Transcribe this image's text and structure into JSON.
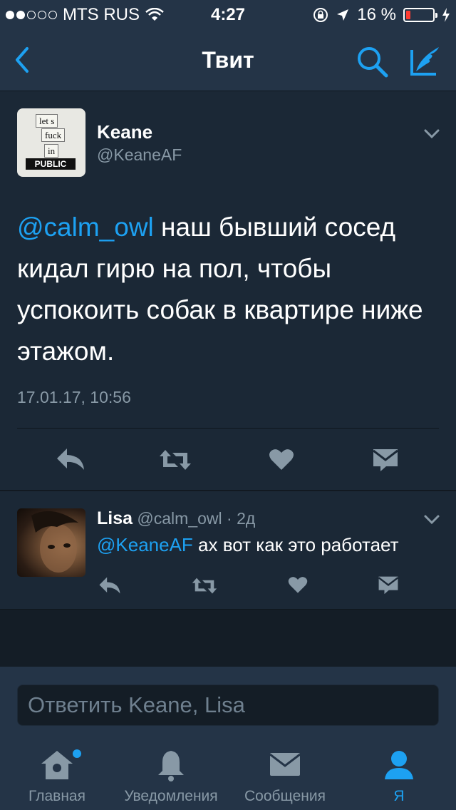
{
  "status_bar": {
    "carrier": "MTS RUS",
    "time": "4:27",
    "battery_percent": "16 %",
    "signal_bars_filled": 2,
    "signal_bars_total": 5,
    "battery_level": 0.16
  },
  "nav": {
    "title": "Твит",
    "back_icon": "chevron-left-icon",
    "search_icon": "search-icon",
    "compose_icon": "compose-icon"
  },
  "tweet": {
    "author_name": "Keane",
    "author_handle": "@KeaneAF",
    "avatar_notes": [
      "let s",
      "fuck",
      "in",
      "PUBLIC"
    ],
    "mention": "@calm_owl",
    "text": " наш бывший сосед кидал гирю на пол, чтобы успокоить собак в квартире ниже этажом.",
    "timestamp": "17.01.17, 10:56",
    "actions": [
      "reply-icon",
      "retweet-icon",
      "like-icon",
      "dm-icon"
    ]
  },
  "reply": {
    "author_name": "Lisa",
    "author_handle": "@calm_owl",
    "age": "· 2д",
    "mention": "@KeaneAF",
    "text": " ах вот как это работает"
  },
  "composer": {
    "placeholder": "Ответить Keane, Lisa"
  },
  "tabbar": {
    "tabs": [
      {
        "label": "Главная",
        "icon": "home-icon",
        "has_badge": true
      },
      {
        "label": "Уведомления",
        "icon": "bell-icon"
      },
      {
        "label": "Сообщения",
        "icon": "envelope-icon"
      },
      {
        "label": "Я",
        "icon": "person-icon",
        "active": true
      }
    ]
  },
  "colors": {
    "accent": "#1da1f2",
    "background": "#141d26",
    "card": "#1b2836",
    "bar": "#243447",
    "muted": "#8899a6"
  }
}
